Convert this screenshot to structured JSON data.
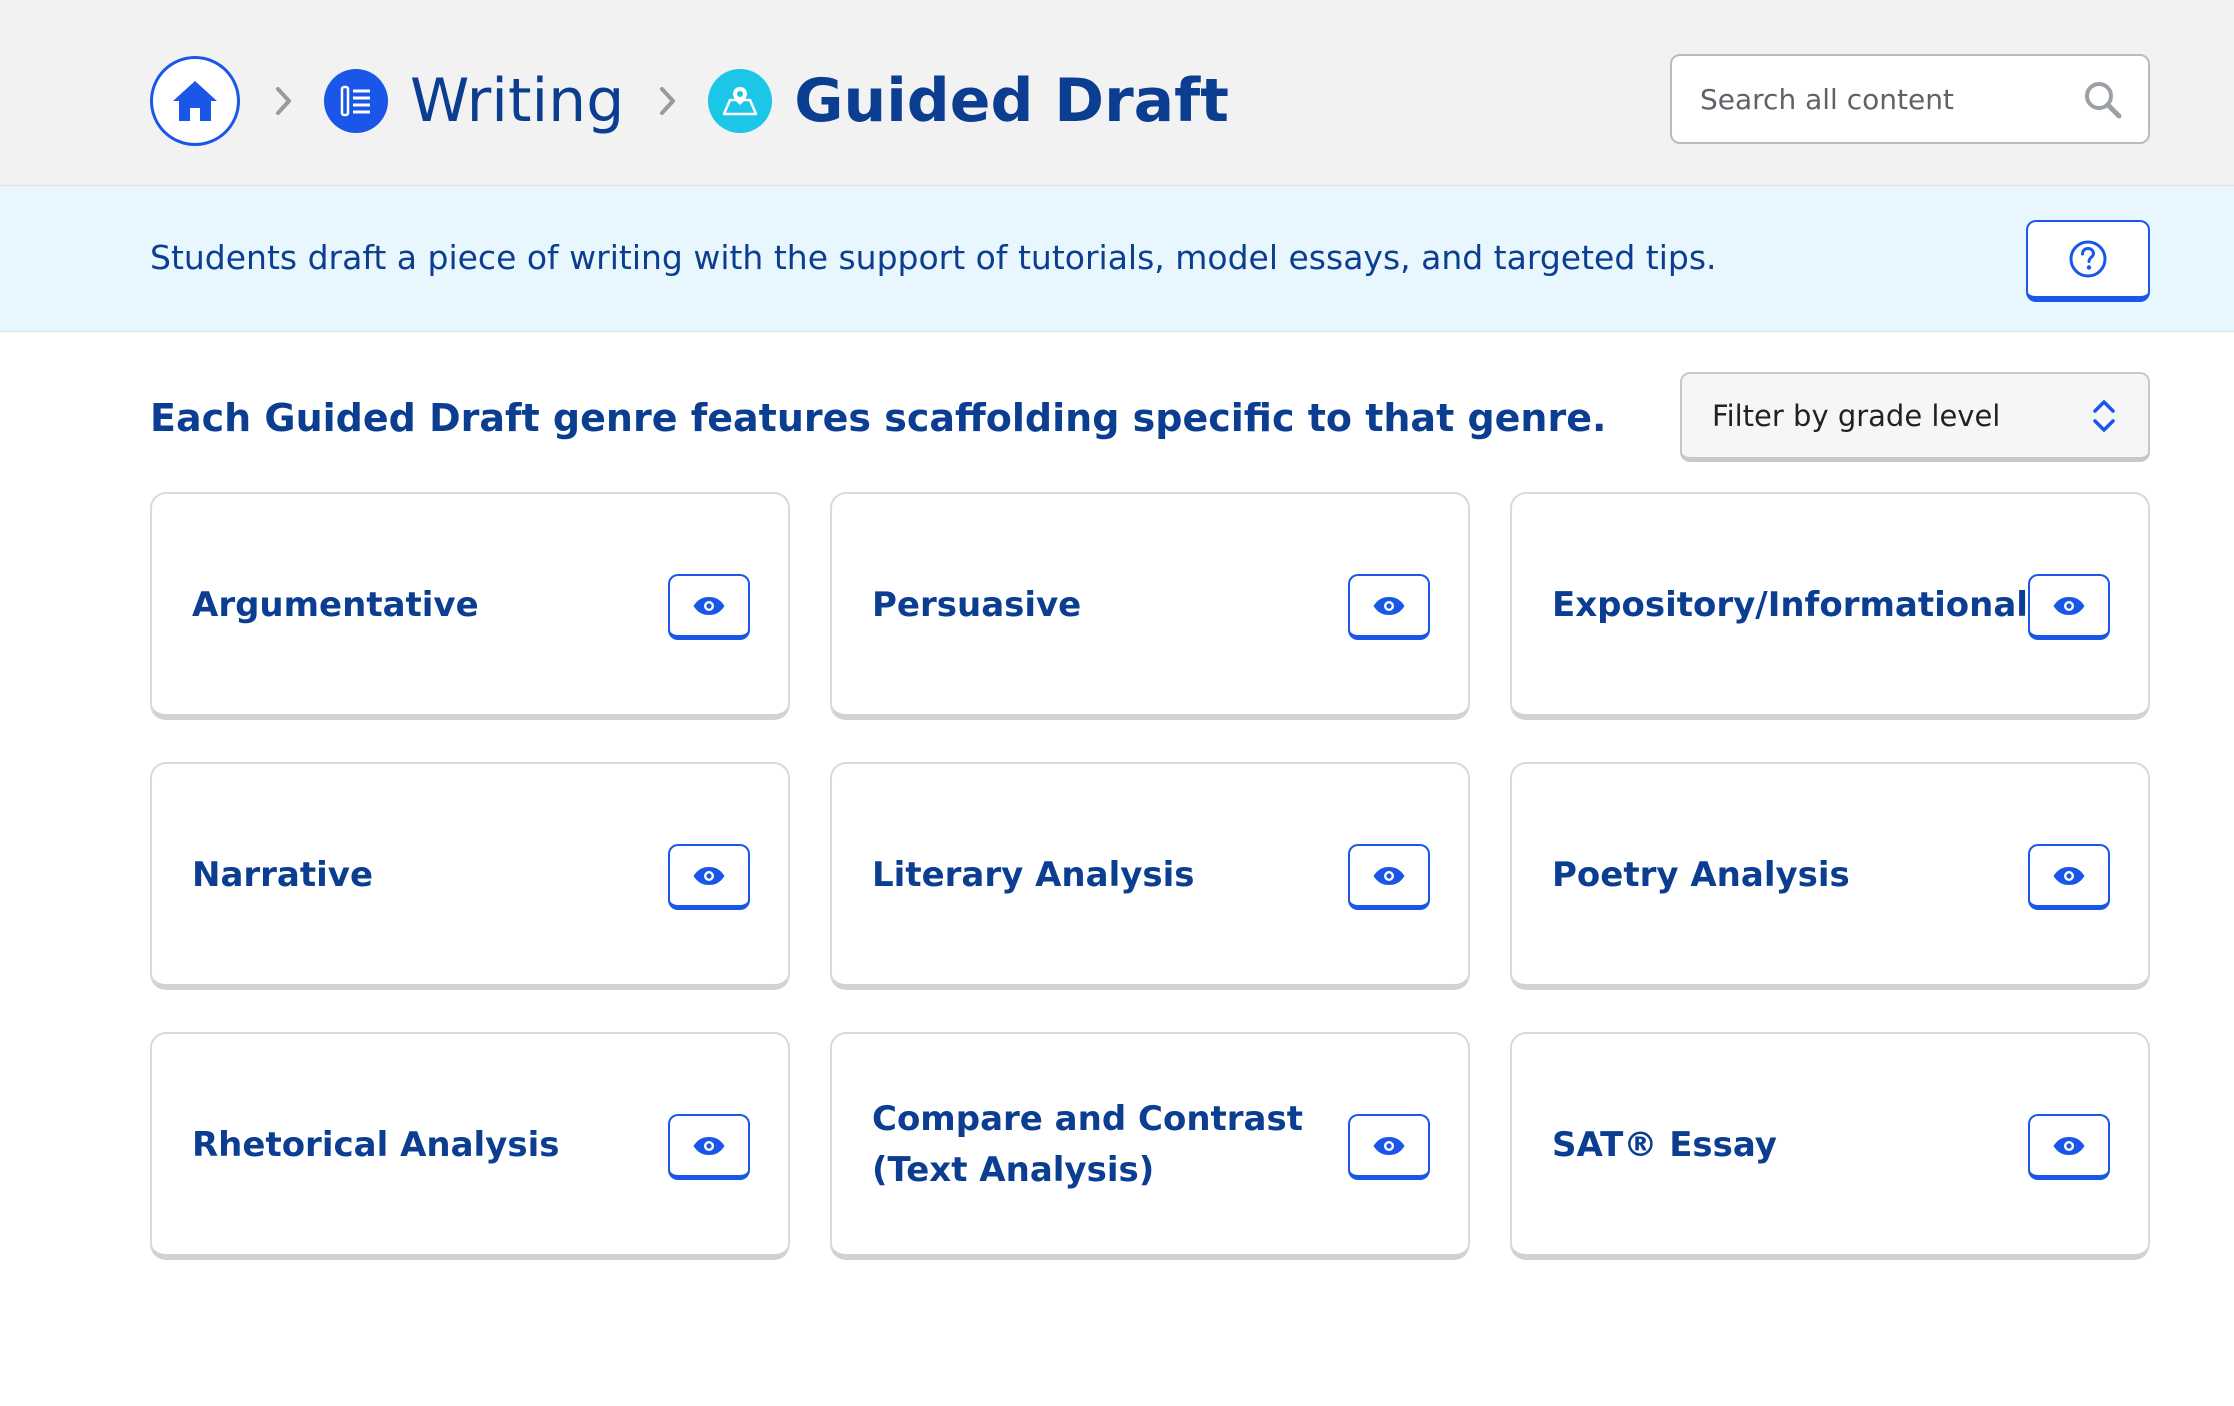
{
  "breadcrumb": {
    "home_label": "Home",
    "items": [
      {
        "label": "Writing",
        "icon": "writing-list-icon"
      },
      {
        "label": "Guided Draft",
        "icon": "guided-draft-icon"
      }
    ]
  },
  "search": {
    "placeholder": "Search all content"
  },
  "info": {
    "text": "Students draft a piece of writing with the support of tutorials, model essays, and targeted tips."
  },
  "section": {
    "title": "Each Guided Draft genre features scaffolding specific to that genre."
  },
  "filter": {
    "label": "Filter by grade level"
  },
  "cards": [
    {
      "title": "Argumentative"
    },
    {
      "title": "Persuasive"
    },
    {
      "title": "Expository/Informational"
    },
    {
      "title": "Narrative"
    },
    {
      "title": "Literary Analysis"
    },
    {
      "title": "Poetry Analysis"
    },
    {
      "title": "Rhetorical Analysis"
    },
    {
      "title": "Compare and Contrast (Text Analysis)"
    },
    {
      "title": "SAT® Essay"
    }
  ],
  "colors": {
    "primary": "#1a56e8",
    "text": "#0b3d91",
    "accent": "#1cc6e6",
    "band": "#e8f6fd"
  }
}
